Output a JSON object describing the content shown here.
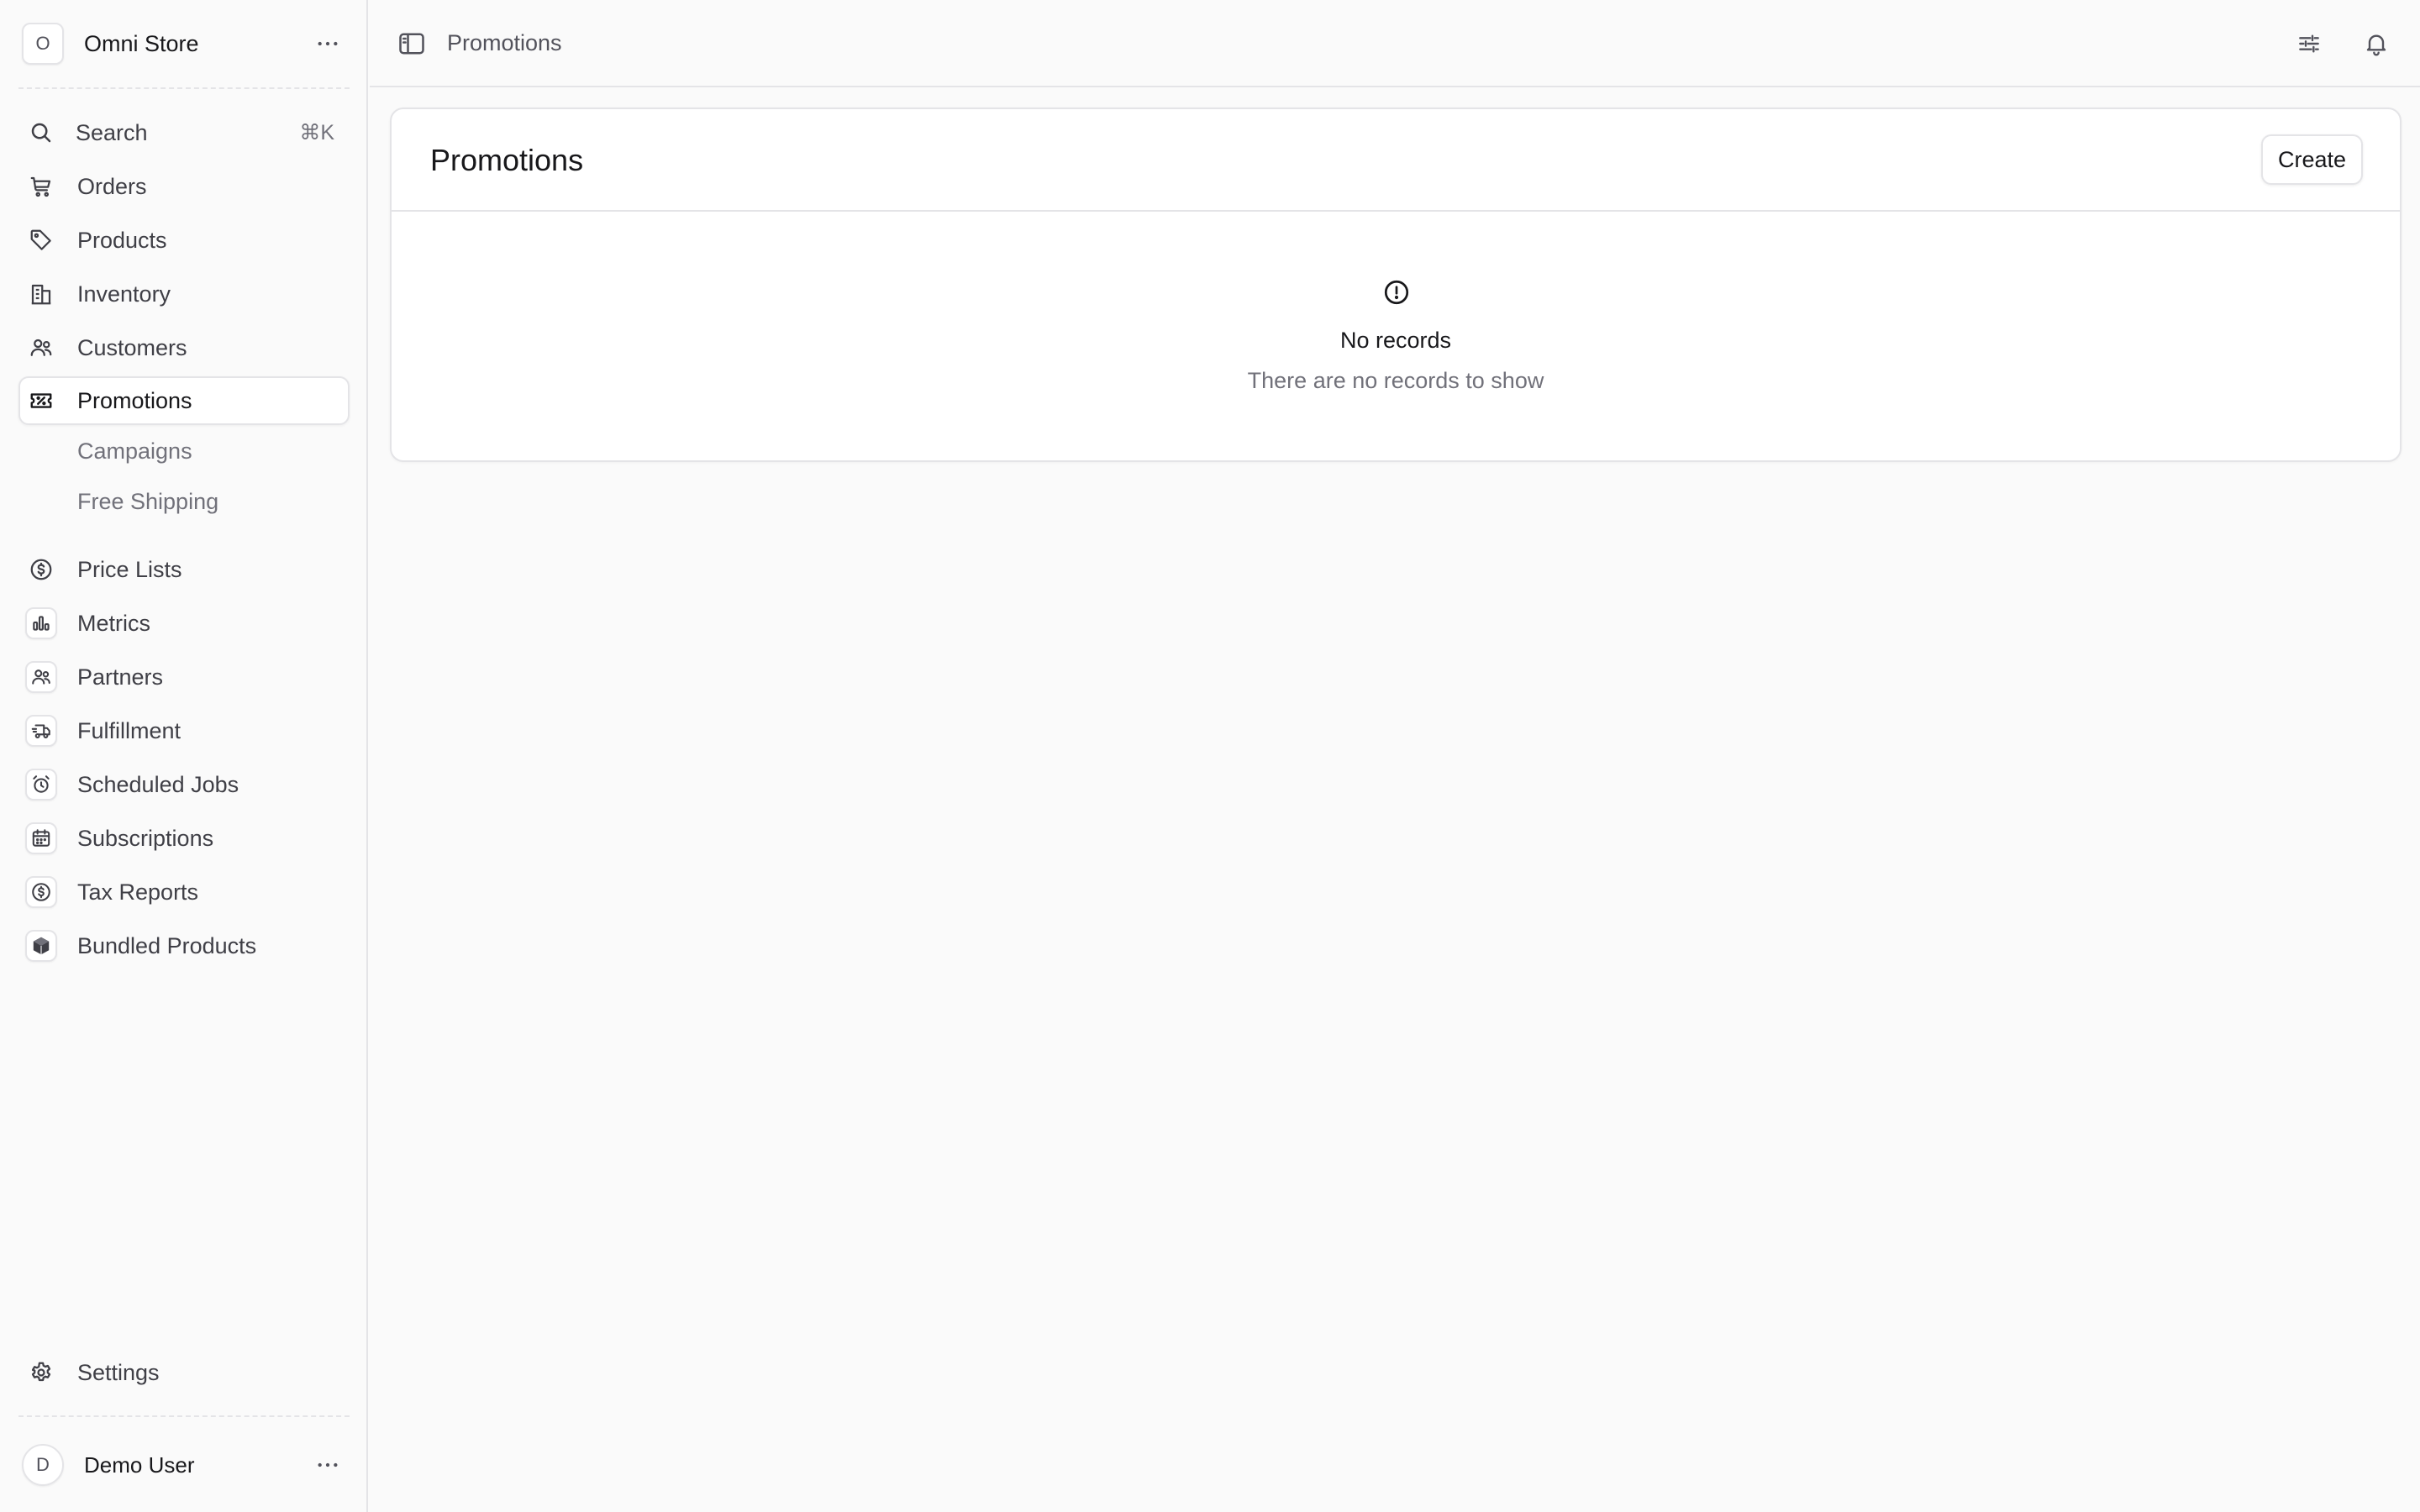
{
  "store": {
    "initial": "O",
    "name": "Omni Store"
  },
  "search": {
    "label": "Search",
    "shortcut": "⌘K"
  },
  "nav": {
    "orders": "Orders",
    "products": "Products",
    "inventory": "Inventory",
    "customers": "Customers",
    "promotions": "Promotions",
    "campaigns": "Campaigns",
    "free_shipping": "Free Shipping",
    "price_lists": "Price Lists",
    "metrics": "Metrics",
    "partners": "Partners",
    "fulfillment": "Fulfillment",
    "scheduled_jobs": "Scheduled Jobs",
    "subscriptions": "Subscriptions",
    "tax_reports": "Tax Reports",
    "bundled_products": "Bundled Products",
    "settings": "Settings"
  },
  "user": {
    "initial": "D",
    "name": "Demo User"
  },
  "topbar": {
    "breadcrumb": "Promotions"
  },
  "page": {
    "title": "Promotions",
    "create_label": "Create",
    "empty_title": "No records",
    "empty_subtitle": "There are no records to show"
  },
  "colors": {
    "active_bg": "#ffffff",
    "border": "#e4e4e7",
    "muted_text": "#71717a"
  }
}
